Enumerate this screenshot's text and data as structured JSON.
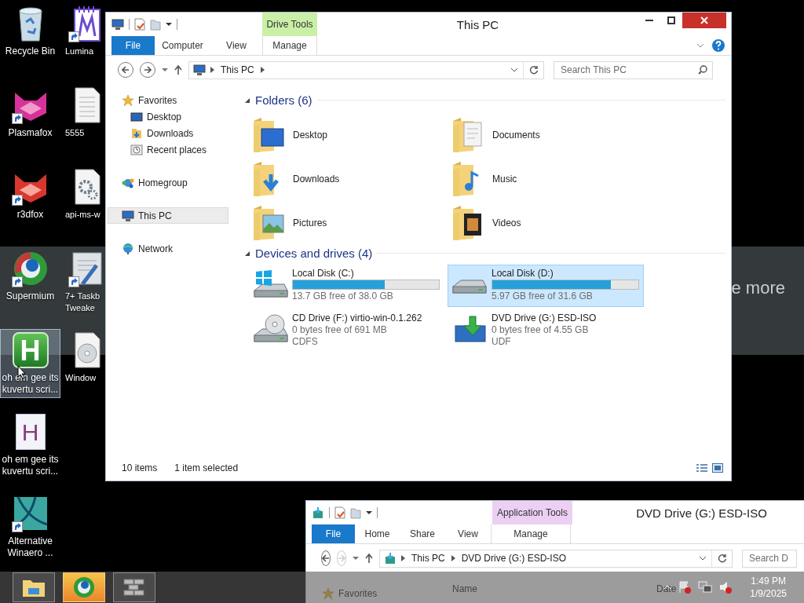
{
  "desktop": {
    "column_1": [
      {
        "label": "Recycle Bin",
        "kind": "bin",
        "shortcut": false,
        "selected": false
      },
      {
        "label": "Plasmafox",
        "kind": "fox",
        "shortcut": true,
        "selected": false
      },
      {
        "label": "r3dfox",
        "kind": "redfox",
        "shortcut": true,
        "selected": false
      },
      {
        "label": "Supermium",
        "kind": "browser",
        "shortcut": true,
        "selected": false
      },
      {
        "label": "oh em gee its kuvertu scri...",
        "kind": "happ",
        "glyph": "H",
        "shortcut": false,
        "selected": true
      },
      {
        "label": "oh em gee its kuvertu scri...",
        "kind": "hfile",
        "glyph": "H",
        "shortcut": false,
        "selected": false
      },
      {
        "label": "Alternative Winaero ...",
        "kind": "winaero",
        "shortcut": true,
        "selected": false
      }
    ],
    "column_2": [
      {
        "label": "Lumina",
        "kind": "lumina",
        "shortcut": true,
        "selected": false
      },
      {
        "label": "5555",
        "kind": "textfile",
        "shortcut": false,
        "selected": false
      },
      {
        "label": "api-ms-w",
        "kind": "gearfile",
        "shortcut": false,
        "selected": false
      },
      {
        "label": "7+ Taskb Tweake",
        "kind": "tweaker",
        "shortcut": true,
        "selected": false
      },
      {
        "label": "Window",
        "kind": "disc",
        "shortcut": false,
        "selected": false
      }
    ]
  },
  "background_window": {
    "text": "e more"
  },
  "explorer": {
    "title": "This PC",
    "context_tab": {
      "label": "Drive Tools",
      "kind": "drive"
    },
    "ribbon_tabs": [
      {
        "label": "File",
        "kind": "file"
      },
      {
        "label": "Computer",
        "kind": "standard"
      },
      {
        "label": "View",
        "kind": "standard"
      },
      {
        "label": "Manage",
        "kind": "contextual"
      }
    ],
    "address": {
      "forward_enabled": true,
      "crumbs": [
        "This PC"
      ]
    },
    "search": {
      "placeholder": "Search This PC"
    },
    "nav": [
      {
        "label": "Favorites",
        "kind": "favorites",
        "selected": false,
        "children": [
          {
            "label": "Desktop",
            "kind": "desktop",
            "selected": false
          },
          {
            "label": "Downloads",
            "kind": "downloads",
            "selected": false
          },
          {
            "label": "Recent places",
            "kind": "recent",
            "selected": false
          }
        ]
      },
      {
        "label": "Homegroup",
        "kind": "homegroup",
        "selected": false
      },
      {
        "label": "This PC",
        "kind": "pc",
        "selected": true
      },
      {
        "label": "Network",
        "kind": "network",
        "selected": false
      }
    ],
    "folders": {
      "heading": "Folders (6)",
      "items": [
        {
          "name": "Desktop",
          "kind": "desktop"
        },
        {
          "name": "Documents",
          "kind": "documents"
        },
        {
          "name": "Downloads",
          "kind": "downloads"
        },
        {
          "name": "Music",
          "kind": "music"
        },
        {
          "name": "Pictures",
          "kind": "pictures"
        },
        {
          "name": "Videos",
          "kind": "videos"
        }
      ]
    },
    "drives": {
      "heading": "Devices and drives (4)",
      "items": [
        {
          "name": "Local Disk (C:)",
          "kind": "system",
          "level": 0.63,
          "free": "13.7 GB free of 38.0 GB",
          "selected": false
        },
        {
          "name": "Local Disk (D:)",
          "kind": "disk",
          "level": 0.81,
          "free": "5.97 GB free of 31.6 GB",
          "selected": true
        },
        {
          "name": "CD Drive (F:) virtio-win-0.1.262",
          "kind": "cd",
          "free": "0 bytes free of 691 MB",
          "filesystem": "CDFS",
          "selected": false
        },
        {
          "name": "DVD Drive (G:) ESD-ISO",
          "kind": "dvd",
          "free": "0 bytes free of 4.55 GB",
          "filesystem": "UDF",
          "selected": false
        }
      ]
    },
    "status_bar": {
      "item_count": "10 items",
      "selection": "1 item selected"
    }
  },
  "explorer_2": {
    "title": "DVD Drive (G:) ESD-ISO",
    "context_tab": {
      "label": "Application Tools",
      "kind": "application"
    },
    "ribbon_tabs": [
      {
        "label": "File",
        "kind": "file"
      },
      {
        "label": "Home",
        "kind": "standard"
      },
      {
        "label": "Share",
        "kind": "standard"
      },
      {
        "label": "View",
        "kind": "standard"
      },
      {
        "label": "Manage",
        "kind": "contextual"
      }
    ],
    "address": {
      "forward_enabled": false,
      "crumbs": [
        "This PC",
        "DVD Drive (G:) ESD-ISO"
      ]
    },
    "search": {
      "placeholder": "Search D"
    },
    "nav": [
      {
        "label": "Favorites",
        "kind": "favorites"
      }
    ],
    "columns": [
      "Name",
      "Date"
    ]
  },
  "taskbar": {
    "apps": [
      {
        "kind": "explorer",
        "active": false
      },
      {
        "kind": "browser",
        "active": true
      },
      {
        "kind": "wall",
        "active": false
      }
    ],
    "clock": {
      "time": "1:49 PM",
      "date": "1/9/2025"
    }
  }
}
